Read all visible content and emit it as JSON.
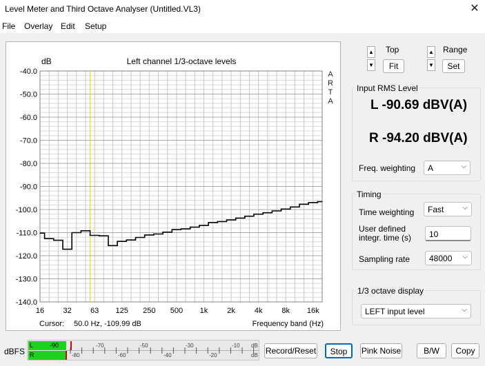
{
  "window": {
    "title": "Level Meter and Third Octave Analyser (Untitled.VL3)",
    "close_glyph": "✕"
  },
  "menu": [
    "File",
    "Overlay",
    "Edit",
    "Setup"
  ],
  "chart_title": "Left channel 1/3-octave levels",
  "chart_unit": "dB",
  "arta_watermark": [
    "A",
    "R",
    "T",
    "A"
  ],
  "cursor_text": "Cursor:",
  "cursor_value": "50.0 Hz, -109.99 dB",
  "x_axis_label": "Frequency band (Hz)",
  "chart_data": {
    "type": "line",
    "step": true,
    "xscale": "log",
    "xlabel": "Frequency band (Hz)",
    "ylabel": "dB",
    "title": "Left channel 1/3-octave levels",
    "ylim": [
      -140,
      -40
    ],
    "y_ticks": [
      "-40.0",
      "-50.0",
      "-60.0",
      "-70.0",
      "-80.0",
      "-90.0",
      "-100.0",
      "-110.0",
      "-120.0",
      "-130.0",
      "-140.0"
    ],
    "x_ticks": [
      "16",
      "32",
      "63",
      "125",
      "250",
      "500",
      "1k",
      "2k",
      "4k",
      "8k",
      "16k"
    ],
    "grid": true,
    "cursor_hz": 50,
    "cursor_color": "#e6d800",
    "line_color": "#000000",
    "bands_hz": [
      "16",
      "20",
      "25",
      "31.5",
      "40",
      "50",
      "63",
      "80",
      "100",
      "125",
      "160",
      "200",
      "250",
      "315",
      "400",
      "500",
      "630",
      "800",
      "1k",
      "1.25k",
      "1.6k",
      "2k",
      "2.5k",
      "3.15k",
      "4k",
      "5k",
      "6.3k",
      "8k",
      "10k",
      "12.5k",
      "16k",
      "20k"
    ],
    "values": [
      -110.2,
      -112.6,
      -113.3,
      -117.2,
      -110.0,
      -109.2,
      -111.2,
      -111.4,
      -115.6,
      -113.8,
      -113.2,
      -112.1,
      -111.0,
      -110.6,
      -109.8,
      -108.7,
      -108.4,
      -107.6,
      -106.9,
      -105.6,
      -105.2,
      -104.5,
      -103.7,
      -102.9,
      -102.0,
      -101.4,
      -100.6,
      -99.8,
      -98.9,
      -97.7,
      -97.0,
      -96.6
    ]
  },
  "controls": {
    "top_label": "Top",
    "fit_label": "Fit",
    "range_label": "Range",
    "set_label": "Set",
    "spin_up": "▲",
    "spin_down": "▼"
  },
  "rms": {
    "group_label": "Input RMS Level",
    "left": "L -90.69 dBV(A)",
    "right": "R -94.20 dBV(A)",
    "freq_weighting_label": "Freq. weighting",
    "freq_weighting_value": "A"
  },
  "timing": {
    "group_label": "Timing",
    "time_weighting_label": "Time weighting",
    "time_weighting_value": "Fast",
    "user_time_label_1": "User defined",
    "user_time_label_2": "integr. time (s)",
    "user_time_value": "10",
    "sampling_rate_label": "Sampling rate",
    "sampling_rate_value": "48000"
  },
  "octave_display": {
    "group_label": "1/3 octave display",
    "value": "LEFT input level"
  },
  "chevron": "⌵",
  "bottom": {
    "dbfs_label": "dBFS",
    "meter_L_label": "L",
    "meter_R_label": "R",
    "meter_L_reading": "-90",
    "meter_top_scale": [
      "-70",
      "-50",
      "-30",
      "-10",
      "dB"
    ],
    "meter_bottom_scale": [
      "-80",
      "-60",
      "-40",
      "-20",
      "dB"
    ],
    "meter_color": "#1fd11f",
    "peak_color": "#e00000",
    "buttons": [
      "Record/Reset",
      "Stop",
      "Pink Noise",
      "B/W",
      "Copy"
    ]
  }
}
